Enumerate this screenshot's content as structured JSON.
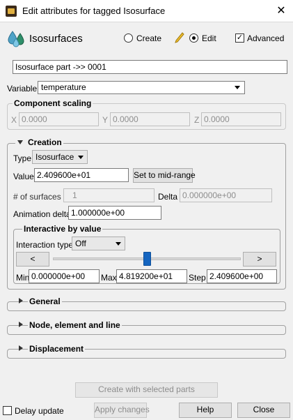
{
  "window": {
    "title": "Edit attributes for tagged Isosurface"
  },
  "header": {
    "title": "Isosurfaces",
    "create_label": "Create",
    "edit_label": "Edit",
    "advanced_label": "Advanced",
    "mode_selected": "Edit",
    "advanced_checked": true
  },
  "part": {
    "value": "Isosurface part ->> 0001"
  },
  "variable": {
    "label": "Variable",
    "value": "temperature"
  },
  "component_scaling": {
    "title": "Component scaling",
    "x_label": "X",
    "x_value": "0.0000",
    "y_label": "Y",
    "y_value": "0.0000",
    "z_label": "Z",
    "z_value": "0.0000"
  },
  "creation": {
    "title": "Creation",
    "type_label": "Type",
    "type_value": "Isosurface",
    "value_label": "Value",
    "value": "2.409600e+01",
    "midrange_button": "Set to mid-range",
    "num_surfaces_label": "# of surfaces",
    "num_surfaces": "1",
    "delta_label": "Delta",
    "delta_value": "0.000000e+00",
    "anim_delta_label": "Animation delta",
    "anim_delta": "1.000000e+00"
  },
  "interactive": {
    "title": "Interactive by value",
    "type_label": "Interaction type",
    "type_value": "Off",
    "prev_button": "<",
    "next_button": ">",
    "slider_fraction": 0.5,
    "min_label": "Min",
    "min_value": "0.000000e+00",
    "max_label": "Max",
    "max_value": "4.819200e+01",
    "step_label": "Step",
    "step_value": "2.409600e+00"
  },
  "sections": {
    "general": "General",
    "node": "Node, element and line",
    "displacement": "Displacement"
  },
  "footer": {
    "create_button": "Create with selected parts",
    "delay_label": "Delay update",
    "apply_button": "Apply changes",
    "help_button": "Help",
    "close_button": "Close"
  },
  "colors": {
    "accent": "#0a64c8",
    "slider_thumb": "#1565c0"
  }
}
